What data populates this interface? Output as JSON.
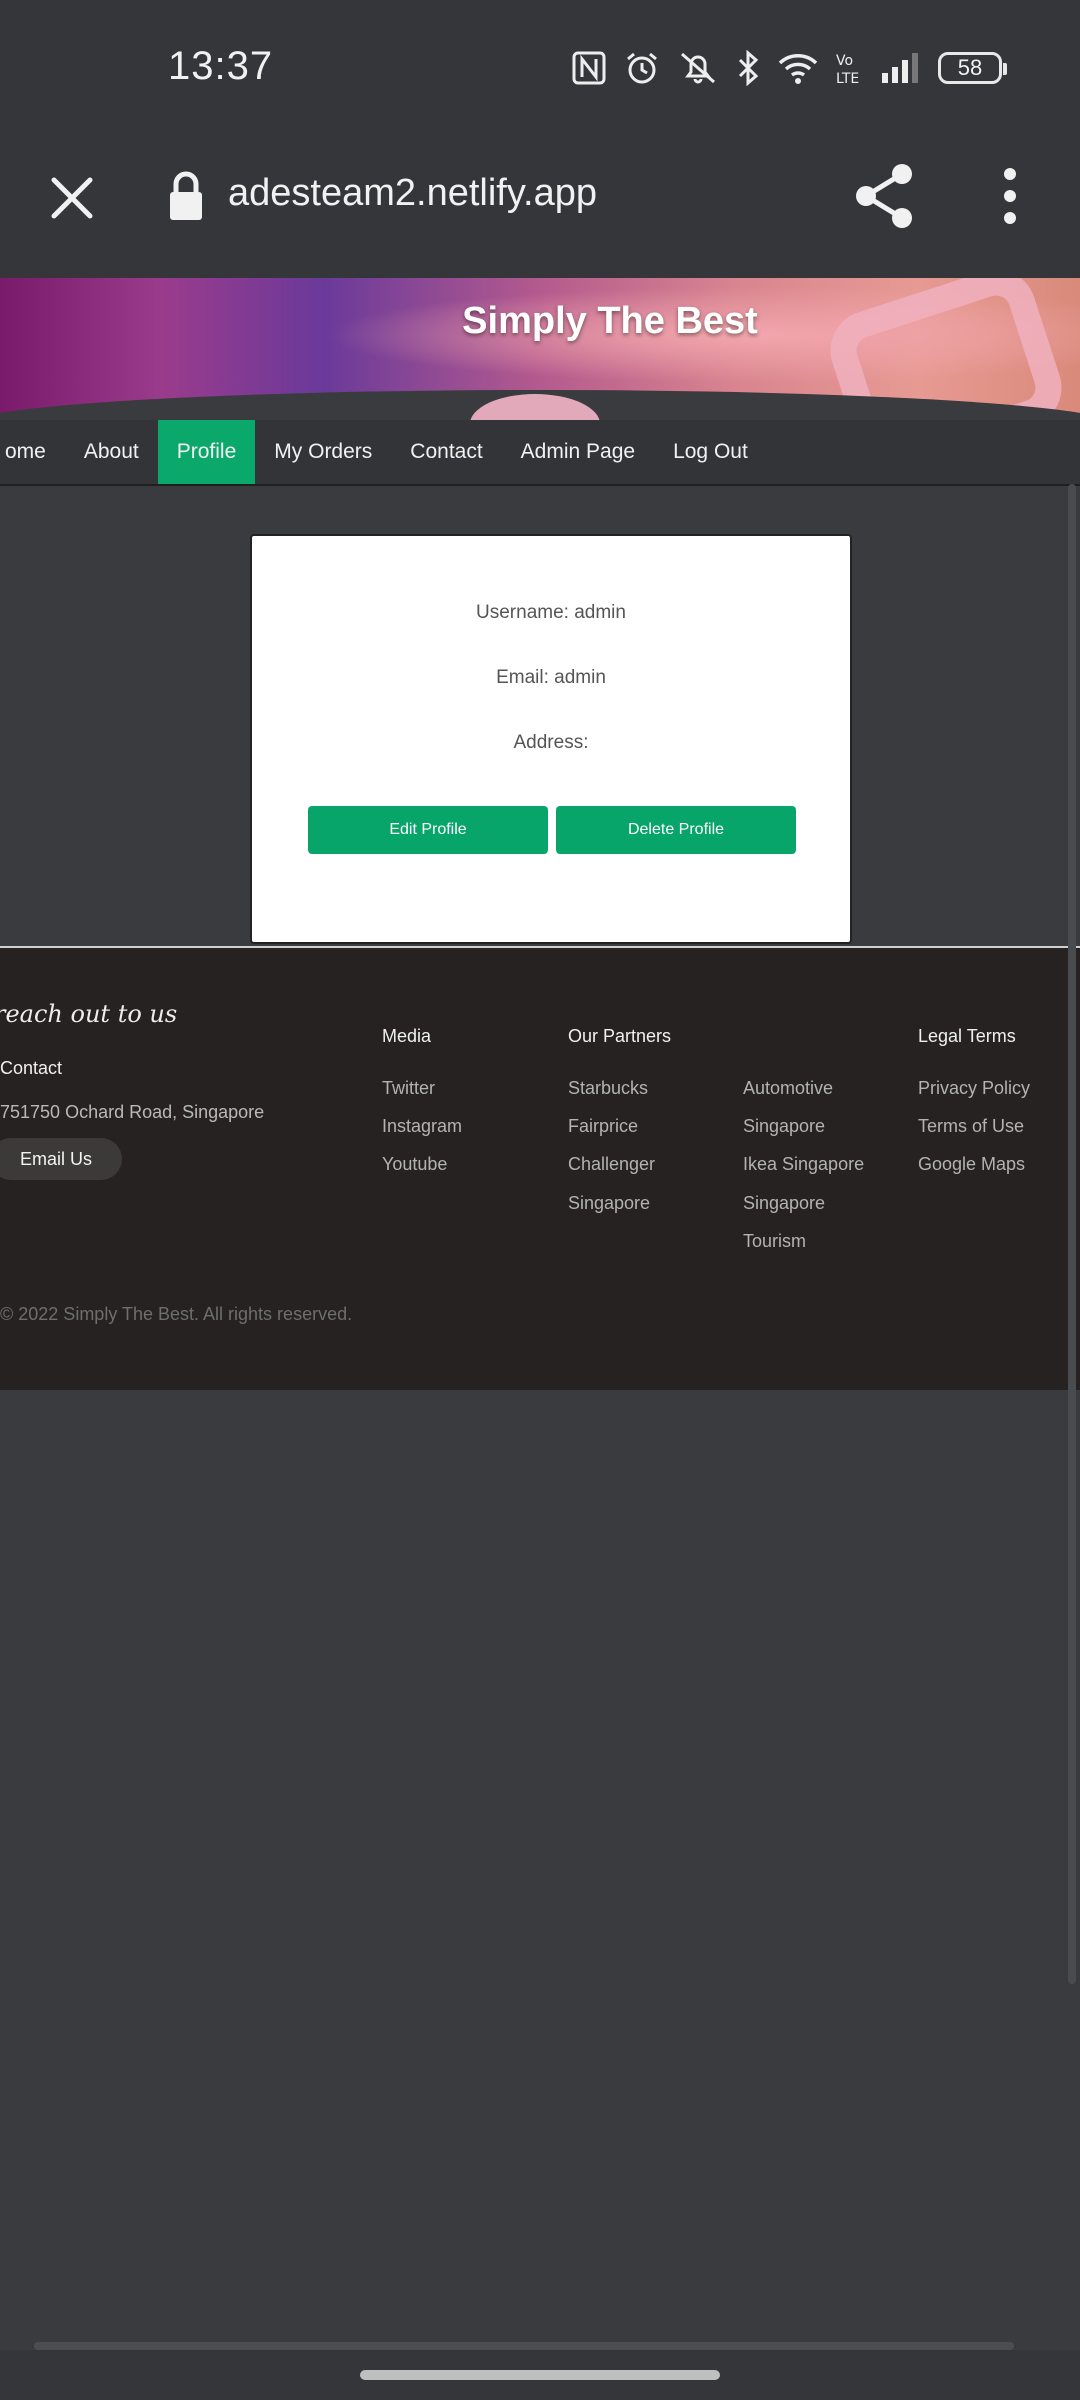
{
  "status_bar": {
    "time": "13:37",
    "battery": "58",
    "icons": [
      "nfc-icon",
      "alarm-icon",
      "mute-icon",
      "bluetooth-icon",
      "wifi-icon",
      "volte-icon",
      "signal-icon",
      "battery-icon"
    ]
  },
  "browser": {
    "url": "adesteam2.netlify.app",
    "icons": [
      "close-icon",
      "lock-icon",
      "share-icon",
      "more-vert-icon"
    ]
  },
  "site": {
    "title": "Simply The Best",
    "nav": [
      {
        "label": "ome"
      },
      {
        "label": "About"
      },
      {
        "label": "Profile",
        "active": true
      },
      {
        "label": "My Orders"
      },
      {
        "label": "Contact"
      },
      {
        "label": "Admin Page"
      },
      {
        "label": "Log Out"
      }
    ],
    "profile": {
      "username_line": "Username: admin",
      "email_line": "Email: admin",
      "address_line": "Address:",
      "edit_button": "Edit Profile",
      "delete_button": "Delete Profile"
    },
    "footer": {
      "tagline": "reach out to us",
      "contact_heading": "Contact",
      "address": "751750 Ochard Road, Singapore",
      "email_button": "Email Us",
      "media_heading": "Media",
      "media_links": [
        "Twitter",
        "Instagram",
        "Youtube"
      ],
      "partners_heading": "Our Partners",
      "partners_col1": [
        "Starbucks",
        "Fairprice",
        "Challenger",
        "Singapore"
      ],
      "partners_col2": [
        "Automotive",
        "Singapore",
        "Ikea Singapore",
        "Singapore",
        "Tourism"
      ],
      "legal_heading": "Legal Terms",
      "legal_links": [
        "Privacy Policy",
        "Terms of Use",
        "Google Maps"
      ],
      "copyright": "© 2022 Simply The Best. All rights reserved."
    }
  },
  "colors": {
    "accent": "#0aa86b",
    "chrome": "#35363a",
    "page_bg": "#3a3b3f",
    "footer_bg": "#252221"
  }
}
